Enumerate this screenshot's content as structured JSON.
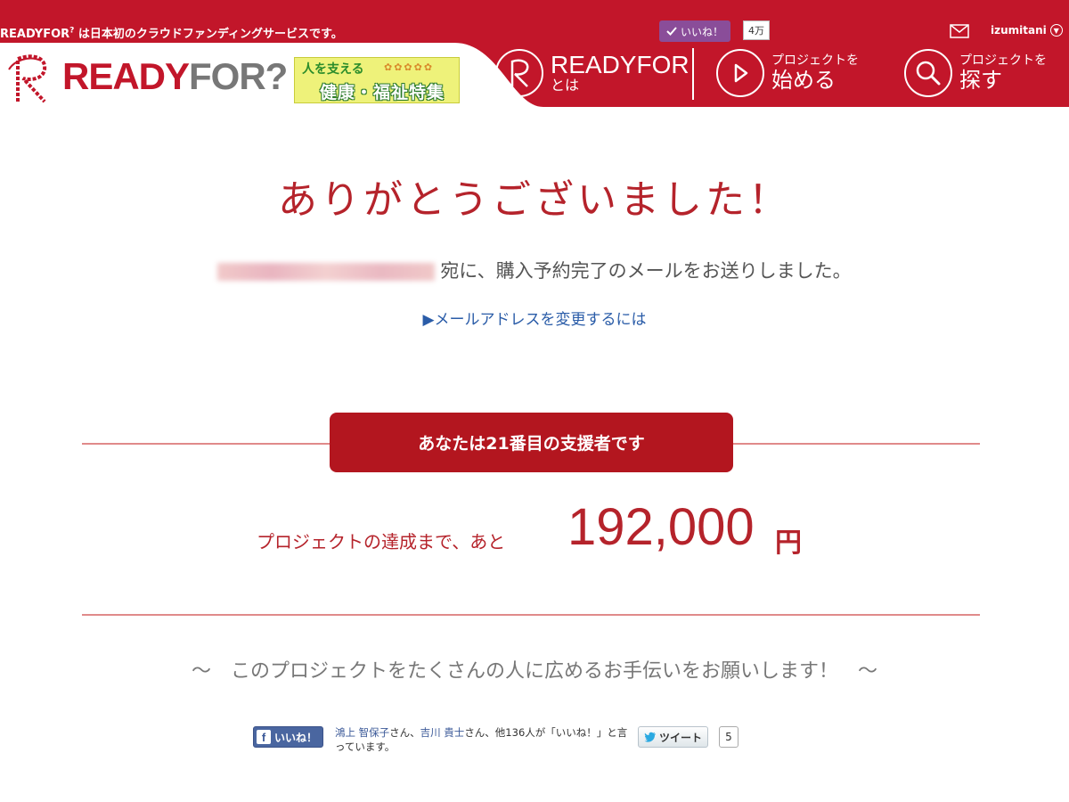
{
  "header": {
    "tagline_brand": "READYFOR",
    "tagline_sup": "?",
    "tagline_text": " は日本初のクラウドファンディングサービスです。",
    "like_button_label": "いいね！",
    "like_count": "4万",
    "username": "izumitani",
    "logo_text_red": "READY",
    "logo_text_grey": "FOR?",
    "banner_small": "人を支える",
    "banner_main": "健康・福祉特集",
    "nav_about_line1": "READYFOR",
    "nav_about_line2": "とは",
    "nav_start_line1": "プロジェクトを",
    "nav_start_line2": "始める",
    "nav_search_line1": "プロジェクトを",
    "nav_search_line2": "探す",
    "icons": [
      "check-icon",
      "mail-icon",
      "chevron-down-icon",
      "readyfor-logo-icon",
      "play-icon",
      "search-icon"
    ]
  },
  "main": {
    "thanks_title": "ありがとうございました！",
    "mail_sent_text": "宛に、購入予約完了のメールをお送りしました。",
    "change_email_link": "▶メールアドレスを変更するには",
    "supporter_badge": "あなたは21番目の支援者です",
    "remaining_label": "プロジェクトの達成まで、あと",
    "remaining_amount": "192,000",
    "remaining_unit": "円",
    "share_request": "〜　このプロジェクトをたくさんの人に広めるお手伝いをお願いします！　〜"
  },
  "social": {
    "fb_like_label": "いいね！",
    "fb_friend1": "鴻上 智保子",
    "fb_san1": "さん、",
    "fb_friend2": "吉川 貴士",
    "fb_rest": "さん、他136人が「いいね！」と言っています。",
    "tweet_label": "ツイート",
    "tweet_count": "5"
  },
  "colors": {
    "brand_red": "#c2162a",
    "text_red": "#b5232b",
    "link_blue": "#2a5ca8",
    "facebook_blue": "#4a66a0"
  }
}
